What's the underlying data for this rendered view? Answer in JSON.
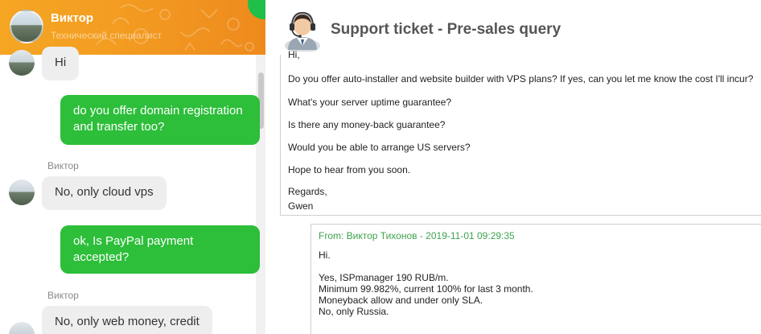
{
  "chat": {
    "agent_name": "Виктор",
    "agent_role": "Технический специалист",
    "messages": [
      {
        "direction": "in",
        "text": "Hi"
      },
      {
        "direction": "out",
        "text": "do you offer domain registration and transfer too?"
      },
      {
        "direction": "in",
        "sender": "Виктор",
        "text": "No, only cloud vps"
      },
      {
        "direction": "out",
        "text": "ok, Is PayPal payment accepted?"
      },
      {
        "direction": "in",
        "sender": "Виктор",
        "text": "No, only web money, credit"
      }
    ]
  },
  "ticket": {
    "title": "Support ticket - Pre-sales query",
    "message_lines": [
      "Hi,",
      "Do you offer auto-installer and website builder with VPS plans? If yes, can you let me know the cost I'll incur?",
      "What's your server uptime guarantee?",
      "Is there any money-back guarantee?",
      "Would you be able to arrange US servers?",
      "Hope to hear from you soon.",
      "Regards,",
      "Gwen"
    ],
    "reply": {
      "from": "From: Виктор Тихонов - 2019-11-01 09:29:35",
      "lines": [
        "Hi.",
        "Yes, ISPmanager 190 RUB/m.",
        "Minimum 99.982%, current 100% for last 3 month.",
        "Moneyback allow and under only SLA.",
        "No, only Russia."
      ]
    }
  },
  "colors": {
    "header_orange": "#f39c21",
    "outgoing_bubble": "#2dbe3a",
    "incoming_bubble": "#eeeeee",
    "reply_from": "#3fa34d"
  },
  "icons": {
    "ticket": "support-agent-headset-icon"
  }
}
